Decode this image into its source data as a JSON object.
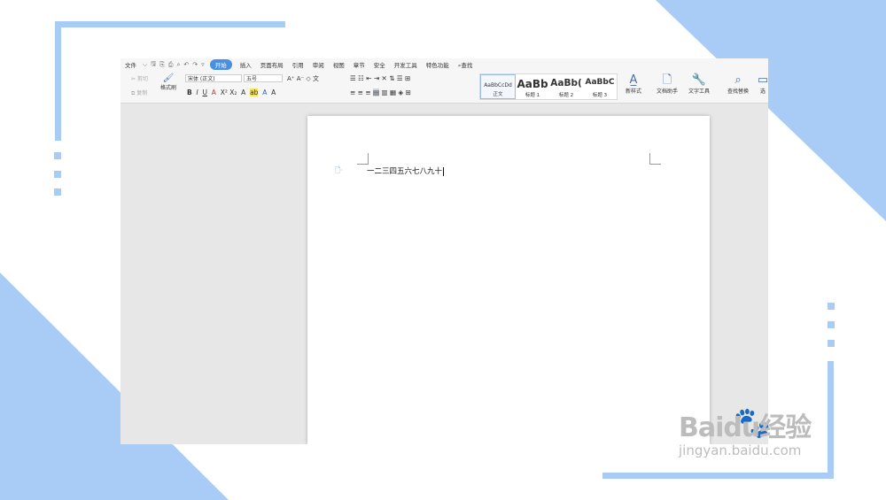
{
  "colors": {
    "accent": "#a9ccf7",
    "active_tab": "#4a90e2"
  },
  "menubar": {
    "file_label": "文件",
    "tabs": [
      {
        "label": "开始",
        "active": true
      },
      {
        "label": "插入"
      },
      {
        "label": "页面布局"
      },
      {
        "label": "引用"
      },
      {
        "label": "审阅"
      },
      {
        "label": "视图"
      },
      {
        "label": "章节"
      },
      {
        "label": "安全"
      },
      {
        "label": "开发工具"
      },
      {
        "label": "特色功能"
      }
    ],
    "search_label": "查找"
  },
  "ribbon": {
    "cut_label": "剪切",
    "copy_label": "复制",
    "format_painter_label": "格式刷",
    "font_name": "宋体 (正文)",
    "font_size": "五号",
    "styles": [
      {
        "preview": "AaBbCcDd",
        "name": "正文"
      },
      {
        "preview": "AaBb",
        "name": "标题 1"
      },
      {
        "preview": "AaBb(",
        "name": "标题 2"
      },
      {
        "preview": "AaBbC",
        "name": "标题 3"
      }
    ],
    "new_style_label": "新样式",
    "doc_helper_label": "文档助手",
    "text_tools_label": "文字工具",
    "find_replace_label": "查找替换",
    "select_label": "选"
  },
  "document": {
    "content": "一二三四五六七八九十"
  },
  "watermark": {
    "logo": "Baidu经验",
    "url": "jingyan.baidu.com"
  }
}
